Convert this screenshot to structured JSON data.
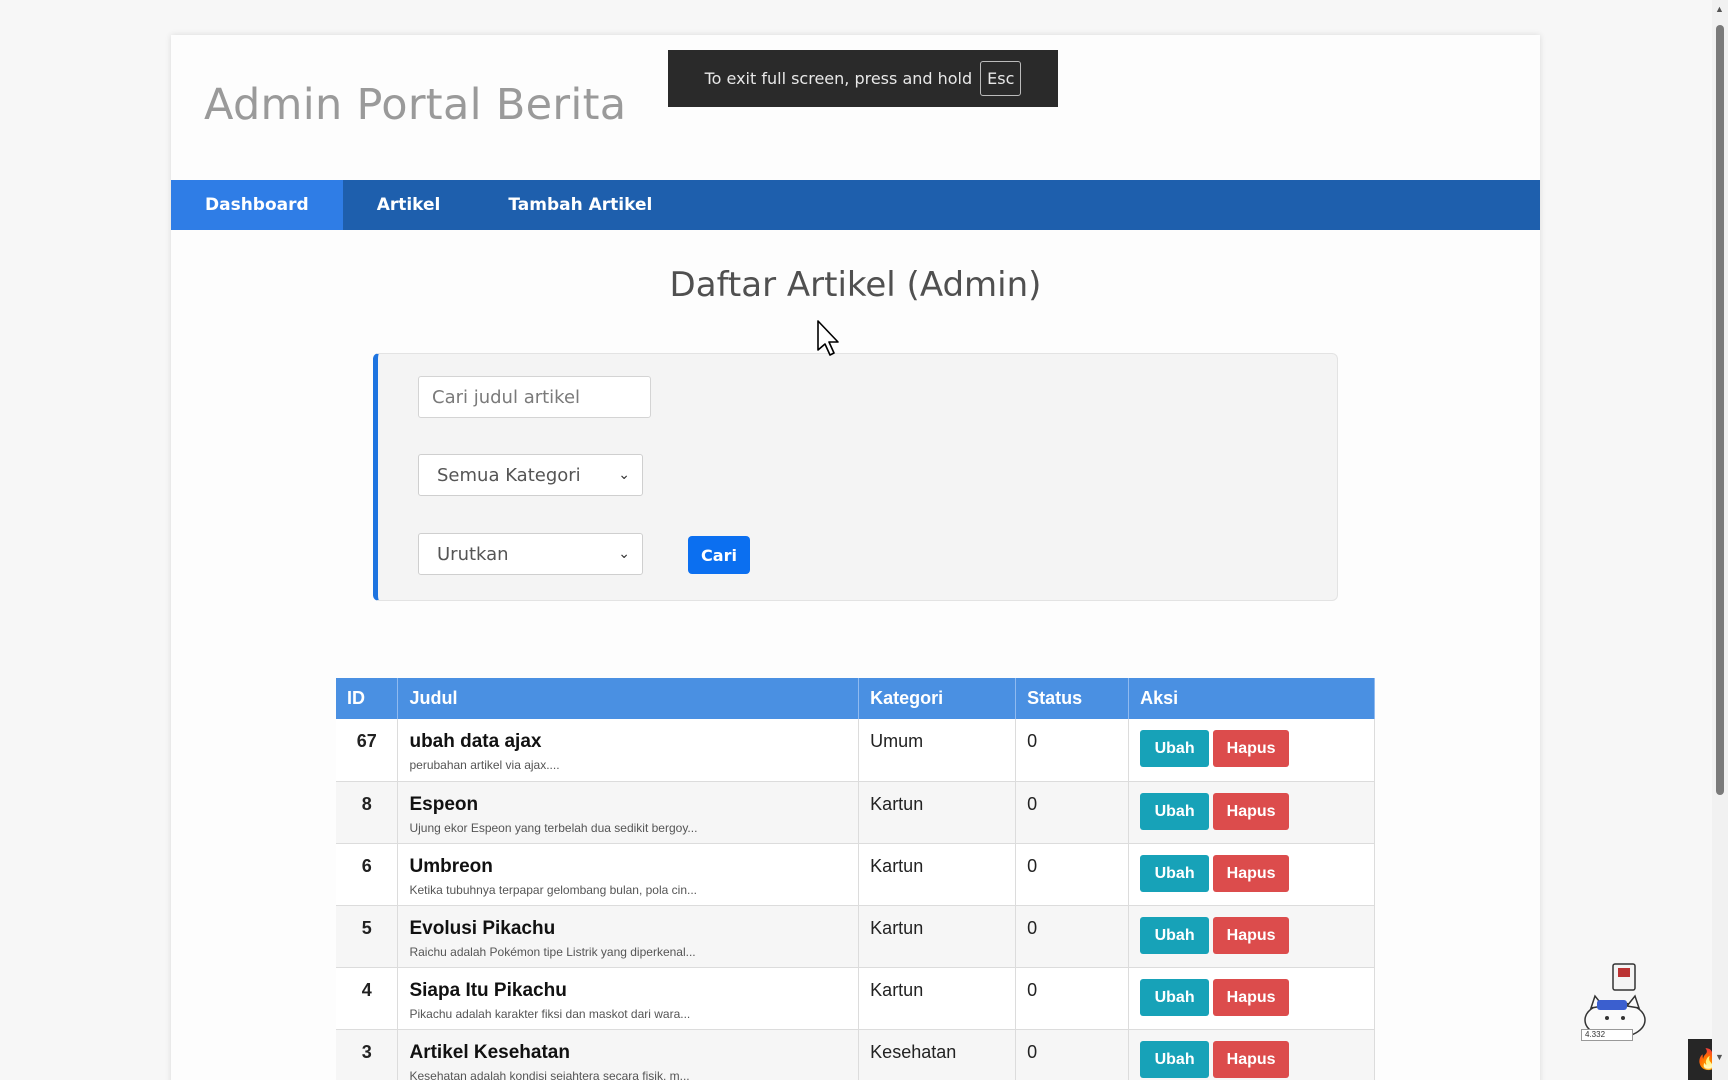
{
  "header": {
    "title": "Admin Portal Berita"
  },
  "nav": [
    {
      "label": "Dashboard",
      "active": true
    },
    {
      "label": "Artikel",
      "active": false
    },
    {
      "label": "Tambah Artikel",
      "active": false
    }
  ],
  "main": {
    "heading": "Daftar Artikel (Admin)"
  },
  "filters": {
    "search_placeholder": "Cari judul artikel",
    "category_select": "Semua Kategori",
    "sort_select": "Urutkan",
    "submit_label": "Cari"
  },
  "table": {
    "columns": [
      "ID",
      "Judul",
      "Kategori",
      "Status",
      "Aksi"
    ],
    "rows": [
      {
        "id": "67",
        "title": "ubah data ajax",
        "excerpt": "perubahan artikel via ajax....",
        "category": "Umum",
        "status": "0"
      },
      {
        "id": "8",
        "title": "Espeon",
        "excerpt": "Ujung ekor Espeon yang terbelah dua sedikit bergoy...",
        "category": "Kartun",
        "status": "0"
      },
      {
        "id": "6",
        "title": "Umbreon",
        "excerpt": "Ketika tubuhnya terpapar gelombang bulan, pola cin...",
        "category": "Kartun",
        "status": "0"
      },
      {
        "id": "5",
        "title": "Evolusi Pikachu",
        "excerpt": "Raichu adalah Pokémon tipe Listrik yang diperkenal...",
        "category": "Kartun",
        "status": "0"
      },
      {
        "id": "4",
        "title": "Siapa Itu Pikachu",
        "excerpt": "Pikachu adalah karakter fiksi dan maskot dari wara...",
        "category": "Kartun",
        "status": "0"
      },
      {
        "id": "3",
        "title": "Artikel Kesehatan",
        "excerpt": "Kesehatan adalah kondisi sejahtera secara fisik, m...",
        "category": "Kesehatan",
        "status": "0"
      }
    ],
    "edit_label": "Ubah",
    "delete_label": "Hapus"
  },
  "fullscreen_toast": {
    "text": "To exit full screen, press and hold",
    "key": "Esc"
  },
  "widget": {
    "counter": "4.332"
  },
  "colors": {
    "nav_bg": "#1e5fad",
    "nav_active": "#2f7de6",
    "table_header": "#4a90e2",
    "btn_primary": "#0b6ff0",
    "btn_edit": "#17a2b8",
    "btn_delete": "#dc4c4c",
    "card_accent": "#1e74e0"
  }
}
